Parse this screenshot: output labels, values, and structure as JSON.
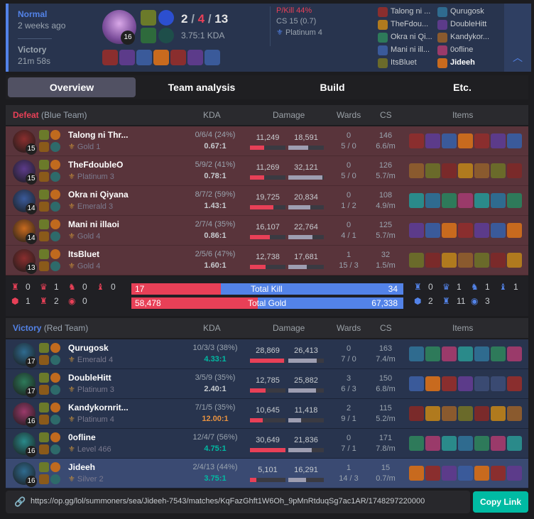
{
  "summary": {
    "queue": "Normal",
    "time_ago": "2 weeks ago",
    "result": "Victory",
    "duration": "21m 58s",
    "level": "16",
    "kills": "2",
    "deaths": "4",
    "assists": "13",
    "kda_ratio": "3.75:1 KDA",
    "pkill": "P/Kill 44%",
    "cs": "CS 15 (0.7)",
    "rank": "Platinum 4",
    "participants": [
      [
        "Talong ni ...",
        "Qurugosk"
      ],
      [
        "TheFdou...",
        "DoubleHitt"
      ],
      [
        "Okra ni Qi...",
        "Kandykor..."
      ],
      [
        "Mani ni ill...",
        "0ofline"
      ],
      [
        "ItsBluet",
        "Jideeh"
      ]
    ]
  },
  "tabs": [
    "Overview",
    "Team analysis",
    "Build",
    "Etc."
  ],
  "headers": {
    "kda": "KDA",
    "damage": "Damage",
    "wards": "Wards",
    "cs": "CS",
    "items": "Items"
  },
  "teams": [
    {
      "result": "Defeat",
      "side": "(Blue Team)",
      "players": [
        {
          "name": "Talong ni Thr...",
          "rank": "Gold 1",
          "level": "15",
          "kda": "0/6/4 (24%)",
          "ratio": "0.67:1",
          "dmg_dealt": "11,249",
          "dmg_taken": "18,591",
          "dealt_frac": 0.4,
          "taken_frac": 0.55,
          "wards": "0",
          "wards2": "5 / 0",
          "cs": "146",
          "csm": "6.6/m"
        },
        {
          "name": "TheFdoubleO",
          "rank": "Platinum 3",
          "level": "15",
          "kda": "5/9/2 (41%)",
          "ratio": "0.78:1",
          "dmg_dealt": "11,269",
          "dmg_taken": "32,121",
          "dealt_frac": 0.4,
          "taken_frac": 0.95,
          "wards": "0",
          "wards2": "5 / 0",
          "cs": "126",
          "csm": "5.7/m"
        },
        {
          "name": "Okra ni Qiyana",
          "rank": "Emerald 3",
          "level": "14",
          "kda": "8/7/2 (59%)",
          "ratio": "1.43:1",
          "dmg_dealt": "19,725",
          "dmg_taken": "20,834",
          "dealt_frac": 0.65,
          "taken_frac": 0.62,
          "wards": "0",
          "wards2": "1 / 2",
          "cs": "108",
          "csm": "4.9/m"
        },
        {
          "name": "Mani ni illaoi",
          "rank": "Gold 4",
          "level": "14",
          "kda": "2/7/4 (35%)",
          "ratio": "0.86:1",
          "dmg_dealt": "16,107",
          "dmg_taken": "22,764",
          "dealt_frac": 0.55,
          "taken_frac": 0.68,
          "wards": "0",
          "wards2": "4 / 1",
          "cs": "125",
          "csm": "5.7/m"
        },
        {
          "name": "ItsBluet",
          "rank": "Gold 4",
          "level": "13",
          "kda": "2/5/6 (47%)",
          "ratio": "1.60:1",
          "dmg_dealt": "12,738",
          "dmg_taken": "17,681",
          "dealt_frac": 0.43,
          "taken_frac": 0.52,
          "wards": "1",
          "wards2": "15 / 3",
          "cs": "32",
          "csm": "1.5/m"
        }
      ]
    },
    {
      "result": "Victory",
      "side": "(Red Team)",
      "players": [
        {
          "name": "Qurugosk",
          "rank": "Emerald 4",
          "level": "17",
          "kda": "10/3/3 (38%)",
          "ratio": "4.33:1",
          "dmg_dealt": "28,869",
          "dmg_taken": "26,413",
          "dealt_frac": 0.95,
          "taken_frac": 0.8,
          "wards": "0",
          "wards2": "7 / 0",
          "cs": "163",
          "csm": "7.4/m"
        },
        {
          "name": "DoubleHitt",
          "rank": "Platinum 3",
          "level": "17",
          "kda": "3/5/9 (35%)",
          "ratio": "2.40:1",
          "dmg_dealt": "12,785",
          "dmg_taken": "25,882",
          "dealt_frac": 0.43,
          "taken_frac": 0.78,
          "wards": "3",
          "wards2": "6 / 3",
          "cs": "150",
          "csm": "6.8/m"
        },
        {
          "name": "Kandykornrit...",
          "rank": "Platinum 4",
          "level": "16",
          "kda": "7/1/5 (35%)",
          "ratio": "12.00:1",
          "dmg_dealt": "10,645",
          "dmg_taken": "11,418",
          "dealt_frac": 0.36,
          "taken_frac": 0.35,
          "wards": "2",
          "wards2": "9 / 1",
          "cs": "115",
          "csm": "5.2/m"
        },
        {
          "name": "0ofline",
          "rank": "Level 466",
          "level": "16",
          "kda": "12/4/7 (56%)",
          "ratio": "4.75:1",
          "dmg_dealt": "30,649",
          "dmg_taken": "21,836",
          "dealt_frac": 1.0,
          "taken_frac": 0.66,
          "wards": "0",
          "wards2": "7 / 1",
          "cs": "171",
          "csm": "7.8/m"
        },
        {
          "name": "Jideeh",
          "rank": "Silver 2",
          "level": "16",
          "kda": "2/4/13 (44%)",
          "ratio": "3.75:1",
          "dmg_dealt": "5,101",
          "dmg_taken": "16,291",
          "dealt_frac": 0.18,
          "taken_frac": 0.5,
          "wards": "1",
          "wards2": "14 / 3",
          "cs": "15",
          "csm": "0.7/m"
        }
      ]
    }
  ],
  "objectives": {
    "blue_top": [
      "0",
      "1",
      "0",
      "0"
    ],
    "blue_bottom": [
      "1",
      "2",
      "0"
    ],
    "red_top": [
      "0",
      "1",
      "1",
      "1"
    ],
    "red_bottom": [
      "2",
      "11",
      "3"
    ],
    "kill_left": "17",
    "kill_label": "Total Kill",
    "kill_right": "34",
    "kill_frac": 0.33,
    "gold_left": "58,478",
    "gold_label": "Total Gold",
    "gold_right": "67,338",
    "gold_frac": 0.465
  },
  "link": {
    "url": "https://op.gg/lol/summoners/sea/Jideeh-7543/matches/KqFazGhft1W6Oh_9pMnRtduqSg7ac1AR/1748297220000",
    "button": "Copy Link"
  },
  "colors": {
    "blue": "#5383e8",
    "red": "#e84057",
    "defeat_bg": "#59343b",
    "victory_bg": "#28344e"
  }
}
